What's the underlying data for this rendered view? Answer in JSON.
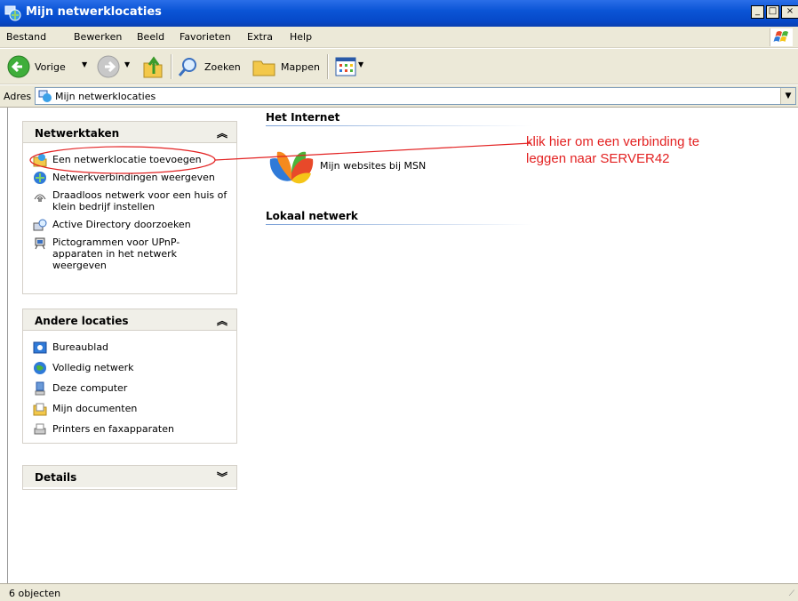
{
  "window": {
    "title": "Mijn netwerklocaties",
    "controls": {
      "minimize": "_",
      "maximize": "□",
      "close": "×"
    }
  },
  "menu": [
    "Bestand",
    "Bewerken",
    "Beeld",
    "Favorieten",
    "Extra",
    "Help"
  ],
  "toolbar": {
    "back": "Vorige",
    "search": "Zoeken",
    "folders": "Mappen"
  },
  "address": {
    "label": "Adres",
    "value": "Mijn netwerklocaties"
  },
  "network_tasks": {
    "title": "Netwerktaken",
    "toggle": "⌃",
    "items": [
      {
        "label": "Een netwerklocatie toevoegen",
        "icon": "add-network-place-icon"
      },
      {
        "label": "Netwerkverbindingen weergeven",
        "icon": "network-connections-icon"
      },
      {
        "label": "Draadloos netwerk voor een huis of klein bedrijf instellen",
        "icon": "wireless-setup-icon"
      },
      {
        "label": "Active Directory doorzoeken",
        "icon": "directory-search-icon"
      },
      {
        "label": "Pictogrammen voor UPnP-apparaten in het netwerk weergeven",
        "icon": "upnp-icon"
      }
    ]
  },
  "other_places": {
    "title": "Andere locaties",
    "toggle": "⌃",
    "items": [
      {
        "label": "Bureaublad",
        "icon": "desktop-icon"
      },
      {
        "label": "Volledig netwerk",
        "icon": "entire-network-icon"
      },
      {
        "label": "Deze computer",
        "icon": "my-computer-icon"
      },
      {
        "label": "Mijn documenten",
        "icon": "my-documents-icon"
      },
      {
        "label": "Printers en faxapparaten",
        "icon": "printers-icon"
      }
    ]
  },
  "details": {
    "title": "Details",
    "toggle": "⌄"
  },
  "content": {
    "internet_group": "Het Internet",
    "msn_item": "Mijn websites bij MSN",
    "local_group": "Lokaal netwerk"
  },
  "annotation": {
    "line1": "klik hier om een verbinding te",
    "line2": "leggen naar SERVER42",
    "color": "#e32222"
  },
  "status": {
    "text": "6 objecten"
  }
}
